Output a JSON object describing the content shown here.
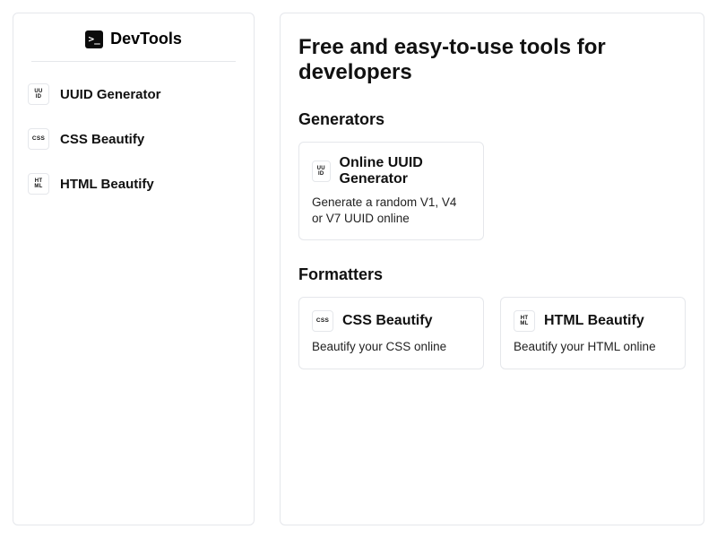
{
  "brand": {
    "name": "DevTools"
  },
  "sidebar": {
    "items": [
      {
        "label": "UUID Generator",
        "iconTop": "UU",
        "iconBottom": "ID"
      },
      {
        "label": "CSS Beautify",
        "iconTop": "CSS",
        "iconBottom": ""
      },
      {
        "label": "HTML Beautify",
        "iconTop": "HT",
        "iconBottom": "ML"
      }
    ]
  },
  "main": {
    "title": "Free and easy-to-use tools for developers",
    "sections": [
      {
        "heading": "Generators",
        "cards": [
          {
            "title": "Online UUID Generator",
            "description": "Generate a random V1, V4 or V7 UUID online",
            "iconTop": "UU",
            "iconBottom": "ID"
          }
        ]
      },
      {
        "heading": "Formatters",
        "cards": [
          {
            "title": "CSS Beautify",
            "description": "Beautify your CSS online",
            "iconTop": "CSS",
            "iconBottom": ""
          },
          {
            "title": "HTML Beautify",
            "description": "Beautify your HTML online",
            "iconTop": "HT",
            "iconBottom": "ML"
          }
        ]
      }
    ]
  }
}
